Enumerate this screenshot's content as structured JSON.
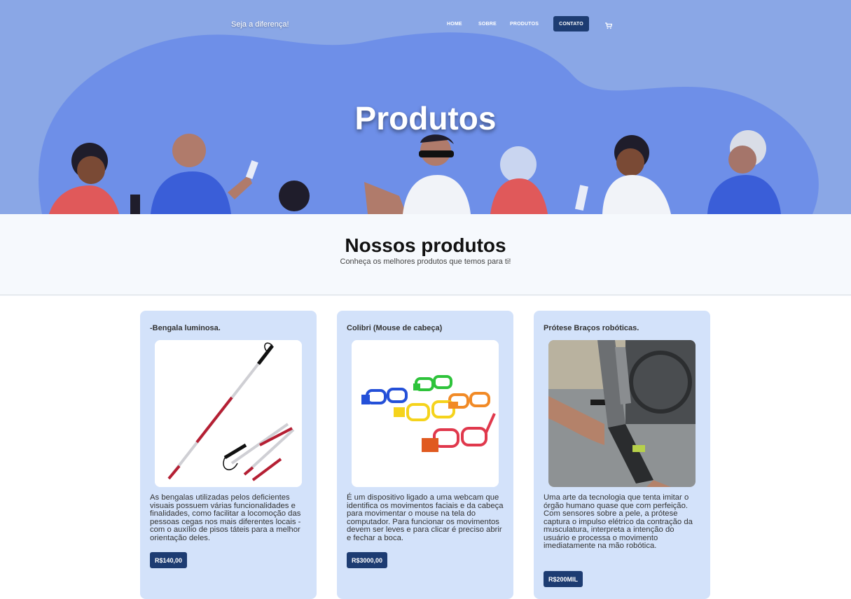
{
  "header": {
    "brand": "Seja a diferença!",
    "nav": {
      "home": "HOME",
      "sobre": "SOBRE",
      "produtos": "PRODUTOS",
      "contato": "CONTATO"
    },
    "cart_icon": "cart-icon",
    "hero_title": "Produtos"
  },
  "section": {
    "title": "Nossos produtos",
    "subtitle": "Conheça os melhores produtos que temos para ti!"
  },
  "products": [
    {
      "title": "-Bengala luminosa.",
      "description": "As bengalas utilizadas pelos deficientes visuais possuem várias funcionalidades e finalidades, como facilitar a locomoção das pessoas cegas nos mais diferentes locais - com o auxílio de pisos táteis para a melhor orientação deles.",
      "price": "R$140,00",
      "image": "white-cane-image"
    },
    {
      "title": "Colibri (Mouse de cabeça)",
      "description": "É um dispositivo ligado a uma webcam que identifica os movimentos faciais e da cabeça para movimentar o mouse na tela do computador. Para funcionar os movimentos devem ser leves e para clicar é preciso abrir e fechar a boca.",
      "price": "R$3000,00",
      "image": "colored-glasses-image"
    },
    {
      "title": "Prótese Braços robóticas.",
      "description": "Uma arte da tecnologia que tenta imitar o órgão humano quase que com perfeição. Com sensores sobre a pele, a prótese captura o impulso elétrico da contração da musculatura, interpreta a intenção do usuário e processa o movimento imediatamente na mão robótica.",
      "price": "R$200MIL",
      "image": "robotic-arm-image"
    }
  ],
  "colors": {
    "hero_bg": "#86a4e4",
    "hero_blob": "#6f8fe6",
    "navy": "#1d3c72",
    "card_bg": "#d3e2fa"
  }
}
